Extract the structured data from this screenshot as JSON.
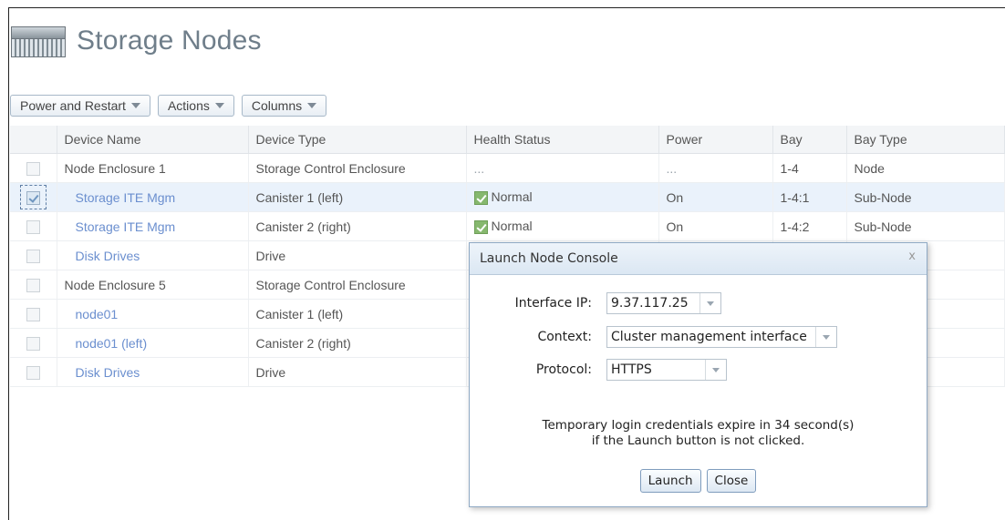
{
  "page": {
    "title": "Storage Nodes"
  },
  "toolbar": {
    "power_label": "Power and Restart",
    "actions_label": "Actions",
    "columns_label": "Columns"
  },
  "table": {
    "headers": [
      "Device Name",
      "Device Type",
      "Health Status",
      "Power",
      "Bay",
      "Bay Type"
    ],
    "rows": [
      {
        "name": "Node Enclosure 1",
        "type": "Storage Control Enclosure",
        "health": "...",
        "power": "...",
        "bay": "1-4",
        "bay_type": "Node"
      },
      {
        "name": "Storage ITE Mgm",
        "type": "Canister 1 (left)",
        "health": "Normal",
        "power": "On",
        "bay": "1-4:1",
        "bay_type": "Sub-Node"
      },
      {
        "name": "Storage ITE Mgm",
        "type": "Canister 2 (right)",
        "health": "Normal",
        "power": "On",
        "bay": "1-4:2",
        "bay_type": "Sub-Node"
      },
      {
        "name": "Disk Drives",
        "type": "Drive"
      },
      {
        "name": "Node Enclosure 5",
        "type": "Storage Control Enclosure"
      },
      {
        "name": "node01",
        "type": "Canister 1 (left)"
      },
      {
        "name": "node01 (left)",
        "type": "Canister 2 (right)"
      },
      {
        "name": "Disk Drives",
        "type": "Drive"
      }
    ]
  },
  "dialog": {
    "title": "Launch Node Console",
    "close_glyph": "x",
    "interface_ip_label": "Interface IP:",
    "interface_ip_value": "9.37.117.25",
    "context_label": "Context:",
    "context_value": "Cluster management interface",
    "protocol_label": "Protocol:",
    "protocol_value": "HTTPS",
    "message_line1": "Temporary login credentials expire in 34 second(s)",
    "message_line2": "if the Launch button is not clicked.",
    "launch_label": "Launch",
    "close_label": "Close"
  }
}
